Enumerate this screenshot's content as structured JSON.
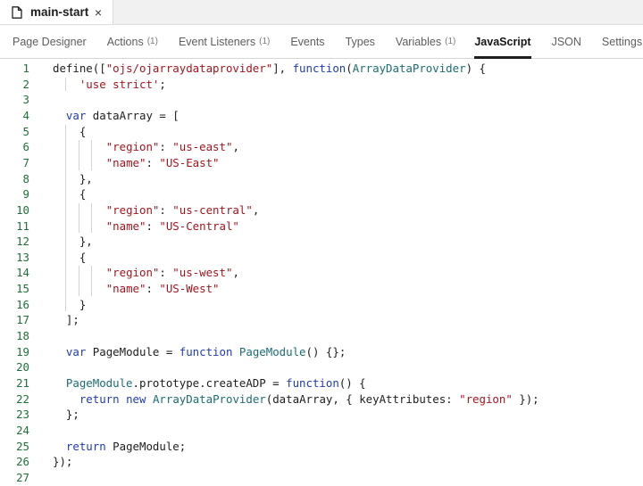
{
  "file_tab": {
    "title": "main-start",
    "icon": "file-icon",
    "close": "×"
  },
  "tabs": [
    {
      "label": "Page Designer",
      "count": ""
    },
    {
      "label": "Actions",
      "count": "(1)"
    },
    {
      "label": "Event Listeners",
      "count": "(1)"
    },
    {
      "label": "Events",
      "count": ""
    },
    {
      "label": "Types",
      "count": ""
    },
    {
      "label": "Variables",
      "count": "(1)"
    },
    {
      "label": "JavaScript",
      "count": ""
    },
    {
      "label": "JSON",
      "count": ""
    },
    {
      "label": "Settings",
      "count": ""
    }
  ],
  "active_tab": "JavaScript",
  "colors": {
    "keyword": "#1f3bb3",
    "string": "#a3151d",
    "class": "#1a6d72",
    "line_number": "#1f6f3a"
  },
  "code_lines": [
    [
      [
        "p",
        "define(["
      ],
      [
        "s",
        "\"ojs/ojarraydataprovider\""
      ],
      [
        "p",
        "], "
      ],
      [
        "k",
        "function"
      ],
      [
        "p",
        "("
      ],
      [
        "c",
        "ArrayDataProvider"
      ],
      [
        "p",
        ") {"
      ]
    ],
    [
      [
        "p",
        "    "
      ],
      [
        "s",
        "'use strict'"
      ],
      [
        "p",
        ";"
      ]
    ],
    [],
    [
      [
        "p",
        "  "
      ],
      [
        "k",
        "var"
      ],
      [
        "p",
        " dataArray = ["
      ]
    ],
    [
      [
        "p",
        "    {"
      ]
    ],
    [
      [
        "p",
        "        "
      ],
      [
        "s",
        "\"region\""
      ],
      [
        "p",
        ": "
      ],
      [
        "s",
        "\"us-east\""
      ],
      [
        "p",
        ","
      ]
    ],
    [
      [
        "p",
        "        "
      ],
      [
        "s",
        "\"name\""
      ],
      [
        "p",
        ": "
      ],
      [
        "s",
        "\"US-East\""
      ]
    ],
    [
      [
        "p",
        "    },"
      ]
    ],
    [
      [
        "p",
        "    {"
      ]
    ],
    [
      [
        "p",
        "        "
      ],
      [
        "s",
        "\"region\""
      ],
      [
        "p",
        ": "
      ],
      [
        "s",
        "\"us-central\""
      ],
      [
        "p",
        ","
      ]
    ],
    [
      [
        "p",
        "        "
      ],
      [
        "s",
        "\"name\""
      ],
      [
        "p",
        ": "
      ],
      [
        "s",
        "\"US-Central\""
      ]
    ],
    [
      [
        "p",
        "    },"
      ]
    ],
    [
      [
        "p",
        "    {"
      ]
    ],
    [
      [
        "p",
        "        "
      ],
      [
        "s",
        "\"region\""
      ],
      [
        "p",
        ": "
      ],
      [
        "s",
        "\"us-west\""
      ],
      [
        "p",
        ","
      ]
    ],
    [
      [
        "p",
        "        "
      ],
      [
        "s",
        "\"name\""
      ],
      [
        "p",
        ": "
      ],
      [
        "s",
        "\"US-West\""
      ]
    ],
    [
      [
        "p",
        "    }"
      ]
    ],
    [
      [
        "p",
        "  ];"
      ]
    ],
    [],
    [
      [
        "p",
        "  "
      ],
      [
        "k",
        "var"
      ],
      [
        "p",
        " PageModule = "
      ],
      [
        "k",
        "function"
      ],
      [
        "p",
        " "
      ],
      [
        "c",
        "PageModule"
      ],
      [
        "p",
        "() {};"
      ]
    ],
    [],
    [
      [
        "p",
        "  "
      ],
      [
        "c",
        "PageModule"
      ],
      [
        "p",
        ".prototype.createADP = "
      ],
      [
        "k",
        "function"
      ],
      [
        "p",
        "() {"
      ]
    ],
    [
      [
        "p",
        "    "
      ],
      [
        "k",
        "return"
      ],
      [
        "p",
        " "
      ],
      [
        "k",
        "new"
      ],
      [
        "p",
        " "
      ],
      [
        "c",
        "ArrayDataProvider"
      ],
      [
        "p",
        "(dataArray, { keyAttributes: "
      ],
      [
        "s",
        "\"region\""
      ],
      [
        "p",
        " });"
      ]
    ],
    [
      [
        "p",
        "  };"
      ]
    ],
    [],
    [
      [
        "p",
        "  "
      ],
      [
        "k",
        "return"
      ],
      [
        "p",
        " PageModule;"
      ]
    ],
    [
      [
        "p",
        "});"
      ]
    ],
    []
  ]
}
